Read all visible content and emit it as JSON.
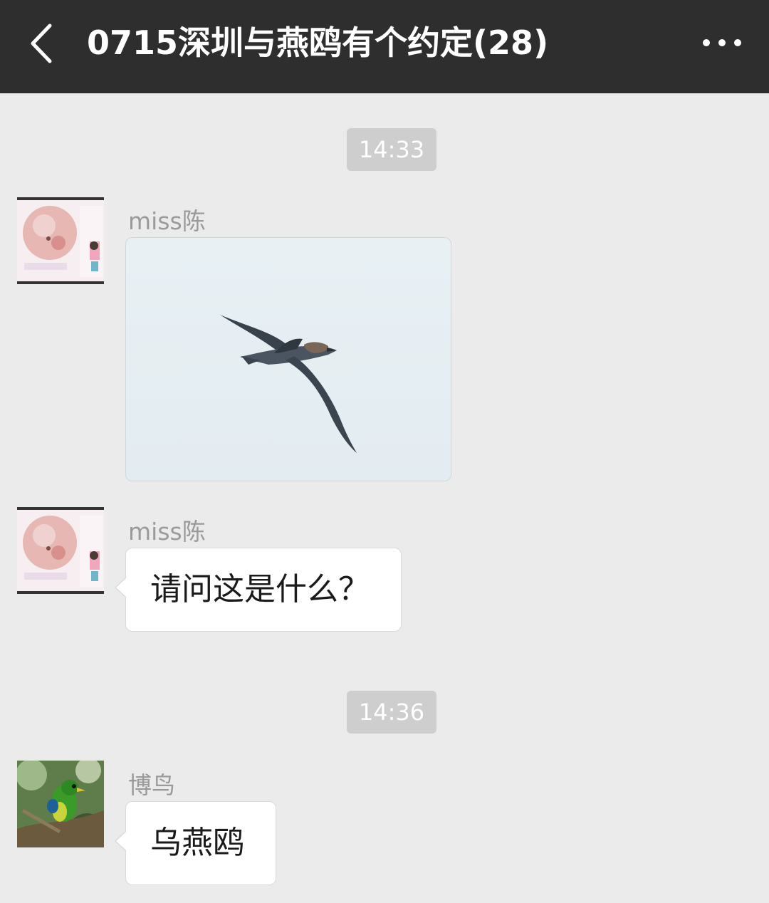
{
  "header": {
    "back_icon": "chevron-left-icon",
    "title": "0715深圳与燕鸥有个约定(28)",
    "more_icon": "ellipsis-icon",
    "background": "#2e2e2e"
  },
  "chat": {
    "background": "#ebebeb",
    "timestamps": [
      "14:33",
      "14:36"
    ],
    "messages": [
      {
        "sender": "miss陈",
        "type": "image",
        "content": "flying-bird-photo"
      },
      {
        "sender": "miss陈",
        "type": "text",
        "content": "请问这是什么？"
      },
      {
        "sender": "博鸟",
        "type": "text",
        "content": "乌燕鸥"
      }
    ]
  }
}
